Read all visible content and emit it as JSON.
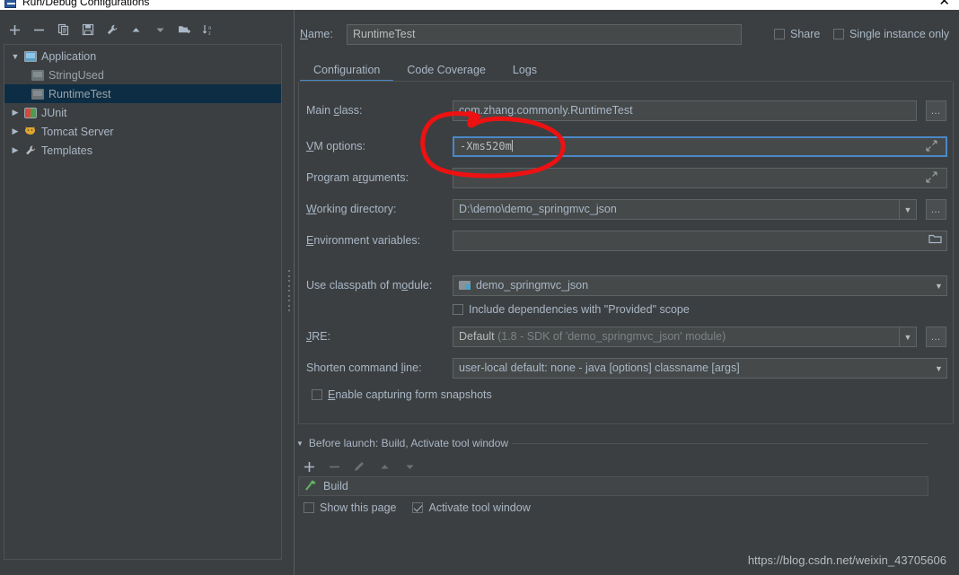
{
  "window": {
    "title": "Run/Debug Configurations",
    "close_label": "✕",
    "icon": "app-window-icon"
  },
  "left_panel": {
    "toolbar": [
      {
        "name": "add-configuration-button",
        "icon": "plus-icon",
        "label": "+"
      },
      {
        "name": "remove-configuration-button",
        "icon": "minus-icon",
        "label": "−"
      },
      {
        "name": "copy-configuration-button",
        "icon": "copy-icon",
        "label": "Copy"
      },
      {
        "name": "save-configuration-button",
        "icon": "save-icon",
        "label": "Save"
      },
      {
        "name": "edit-templates-button",
        "icon": "wrench-icon",
        "label": "Edit Templates"
      },
      {
        "name": "move-up-button",
        "icon": "arrow-up-icon",
        "label": "Move Up"
      },
      {
        "name": "move-down-button",
        "icon": "arrow-down-icon",
        "label": "Move Down"
      },
      {
        "name": "new-folder-button",
        "icon": "new-folder-icon",
        "label": "Create New Folder"
      },
      {
        "name": "sort-configurations-button",
        "icon": "sort-az-icon",
        "label": "Sort Configurations"
      }
    ],
    "tree": [
      {
        "label": "Application",
        "level": 0,
        "expanded": true,
        "icon": "application-icon",
        "selected": false,
        "dim": false
      },
      {
        "label": "StringUsed",
        "level": 1,
        "expanded": null,
        "icon": "application-icon-grey",
        "selected": false,
        "dim": true
      },
      {
        "label": "RuntimeTest",
        "level": 1,
        "expanded": null,
        "icon": "application-icon-grey",
        "selected": true,
        "dim": false
      },
      {
        "label": "JUnit",
        "level": 0,
        "expanded": false,
        "icon": "junit-icon",
        "selected": false,
        "dim": false
      },
      {
        "label": "Tomcat Server",
        "level": 0,
        "expanded": false,
        "icon": "tomcat-icon",
        "selected": false,
        "dim": false
      },
      {
        "label": "Templates",
        "level": 0,
        "expanded": false,
        "icon": "wrench-icon",
        "selected": false,
        "dim": false
      }
    ]
  },
  "header": {
    "name_label": "Name:",
    "name_value": "RuntimeTest",
    "name_placeholder": "",
    "share_label": "Share",
    "share_checked": false,
    "single_instance_label": "Single instance only",
    "single_instance_checked": false
  },
  "tabs": [
    {
      "label": "Configuration",
      "active": true
    },
    {
      "label": "Code Coverage",
      "active": false
    },
    {
      "label": "Logs",
      "active": false
    }
  ],
  "form": {
    "main_class": {
      "label": "Main class:",
      "value": "com.zhang.commonly.RuntimeTest",
      "browse_label": "…"
    },
    "vm_options": {
      "label": "VM options:",
      "value": "-Xms520m",
      "focused": true,
      "expand_icon": "expand-arrows-icon"
    },
    "program_arguments": {
      "label": "Program arguments:",
      "value": "",
      "expand_icon": "expand-arrows-icon"
    },
    "working_directory": {
      "label": "Working directory:",
      "value": "D:\\demo\\demo_springmvc_json",
      "dropdown_icon": "chevron-down-icon",
      "browse_label": "…"
    },
    "environment_variables": {
      "label": "Environment variables:",
      "value": "",
      "browse_icon": "folder-icon"
    },
    "classpath_module": {
      "label": "Use classpath of module:",
      "value": "demo_springmvc_json",
      "module_icon": "module-icon",
      "dropdown_icon": "chevron-down-icon"
    },
    "include_dependencies": {
      "label": "Include dependencies with \"Provided\" scope",
      "checked": false
    },
    "jre": {
      "label": "JRE:",
      "value_primary": "Default",
      "value_secondary": "(1.8 - SDK of 'demo_springmvc_json' module)",
      "dropdown_icon": "chevron-down-icon",
      "browse_label": "…"
    },
    "shorten_command_line": {
      "label": "Shorten command line:",
      "value": "user-local default: none - java [options] classname [args]",
      "dropdown_icon": "chevron-down-icon"
    },
    "form_snapshots": {
      "label": "Enable capturing form snapshots",
      "checked": false
    }
  },
  "before_launch": {
    "header": "Before launch: Build, Activate tool window",
    "collapse_icon": "triangle-down-icon",
    "toolbar": [
      {
        "name": "add-before-launch-task-button",
        "icon": "plus-icon",
        "label": "+",
        "enabled": true
      },
      {
        "name": "remove-before-launch-task-button",
        "icon": "minus-icon",
        "label": "−",
        "enabled": false
      },
      {
        "name": "edit-before-launch-task-button",
        "icon": "pencil-icon",
        "label": "Edit",
        "enabled": false
      },
      {
        "name": "move-task-up-button",
        "icon": "arrow-up-icon",
        "label": "Up",
        "enabled": false
      },
      {
        "name": "move-task-down-button",
        "icon": "arrow-down-icon",
        "label": "Down",
        "enabled": false
      }
    ],
    "tasks": [
      {
        "label": "Build",
        "icon": "hammer-icon"
      }
    ],
    "show_this_page": {
      "label": "Show this page",
      "checked": false
    },
    "activate_tool_window": {
      "label": "Activate tool window",
      "checked": true
    }
  },
  "watermark": "https://blog.csdn.net/weixin_43705606",
  "colors": {
    "background": "#3c3f41",
    "field_background": "#45494a",
    "text": "#a9b7c6",
    "accent": "#4a88c7",
    "selection": "#0d2d44",
    "annotation": "#ee1111"
  }
}
